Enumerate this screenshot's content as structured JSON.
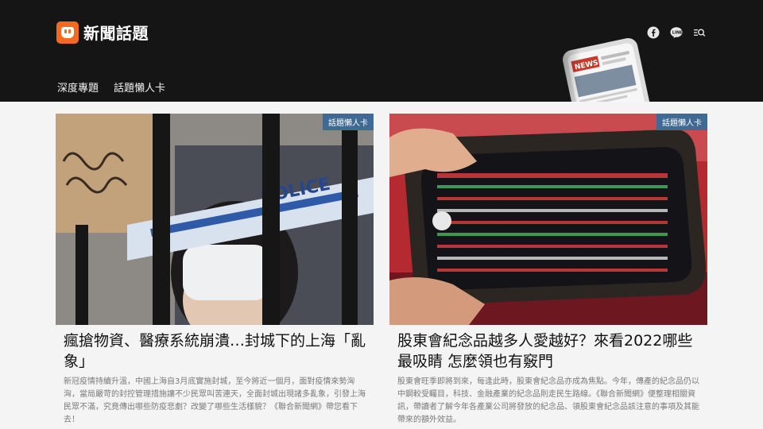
{
  "site": {
    "name": "新聞話題",
    "brand_color": "#f26a1f",
    "header_bg": "#151515"
  },
  "header": {
    "icons": [
      "facebook-icon",
      "line-icon",
      "search-menu-icon"
    ],
    "nav": [
      "深度專題",
      "話題懶人卡"
    ]
  },
  "articles": [
    {
      "badge": "話題懶人卡",
      "title": "瘋搶物資、醫療系統崩潰…封城下的上海「亂象」",
      "description": "新冠疫情持續升溫，中國上海自3月底實施封城，至今將近一個月，面對疫情來勢洶洶，當局嚴苛的封控管理措施讓不少民眾叫苦連天，全面封城出現諸多亂象，引發上海民眾不滿，究竟傳出哪些防疫悲劇？改變了哪些生活樣貌？《聯合新聞網》帶您看下去！"
    },
    {
      "badge": "話題懶人卡",
      "title": "股東會紀念品越多人愛越好？來看2022哪些最吸睛 怎麼領也有竅門",
      "description": "股東會旺季即將到來，每逢此時，股東會紀念品亦成為焦點。今年，傳產的紀念品仍以中鋼較受矚目，科技、金融產業的紀念品則走民生路線。《聯合新聞網》便整理相關資訊，帶讀者了解今年各產業公司將發放的紀念品、領股東會紀念品該注意的事項及其能帶來的額外效益。"
    }
  ]
}
